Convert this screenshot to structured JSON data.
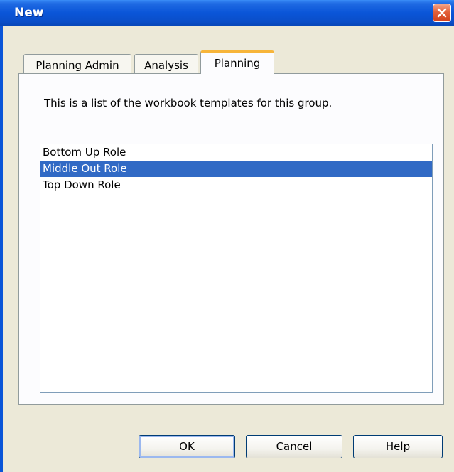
{
  "window": {
    "title": "New",
    "close_icon": "close-icon",
    "titlebar_color": "#0a55d8",
    "close_color": "#d2411c"
  },
  "tabs": [
    {
      "label": "Planning Admin",
      "active": false
    },
    {
      "label": "Analysis",
      "active": false
    },
    {
      "label": "Planning",
      "active": true
    }
  ],
  "panel": {
    "description": "This is a list of the workbook templates for this group."
  },
  "templates": {
    "items": [
      "Bottom Up Role",
      "Middle Out Role",
      "Top Down Role"
    ],
    "selected": "Middle Out Role",
    "selection_color": "#316ac5"
  },
  "buttons": {
    "ok": "OK",
    "cancel": "Cancel",
    "help": "Help"
  }
}
